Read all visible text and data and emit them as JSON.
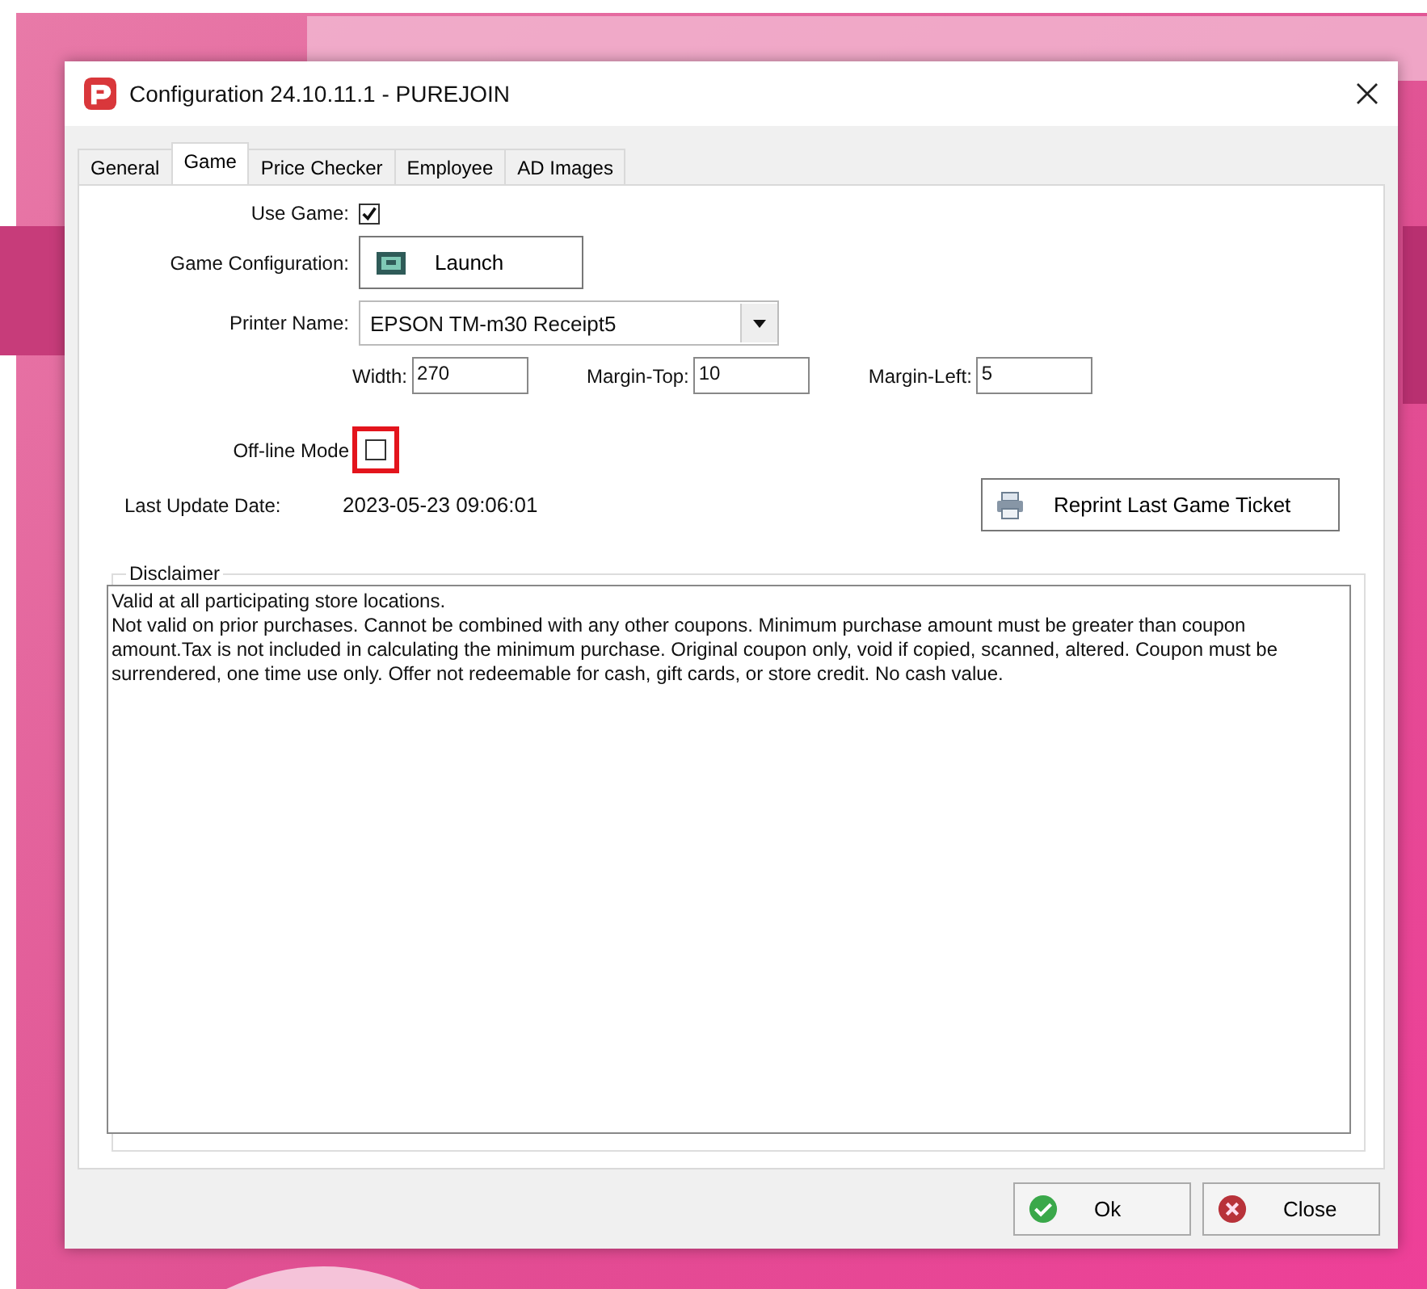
{
  "window": {
    "title": "Configuration 24.10.11.1  - PUREJOIN"
  },
  "tabs": [
    {
      "label": "General",
      "selected": false
    },
    {
      "label": "Game",
      "selected": true
    },
    {
      "label": "Price Checker",
      "selected": false
    },
    {
      "label": "Employee",
      "selected": false
    },
    {
      "label": "AD Images",
      "selected": false
    }
  ],
  "use_game": {
    "label": "Use Game:",
    "checked": true
  },
  "game_configuration": {
    "label": "Game Configuration:",
    "button": "Launch"
  },
  "printer_name": {
    "label": "Printer Name:",
    "value": "EPSON TM-m30 Receipt5"
  },
  "size_fields": [
    {
      "label": "Width:",
      "value": "270"
    },
    {
      "label": "Margin-Top:",
      "value": "10"
    },
    {
      "label": "Margin-Left:",
      "value": "5"
    }
  ],
  "offline_mode": {
    "label": "Off-line Mode",
    "checked": false,
    "highlighted": true
  },
  "last_update": {
    "label": "Last Update Date:",
    "value": "2023-05-23 09:06:01"
  },
  "reprint_button": "Reprint Last Game Ticket",
  "disclaimer": {
    "title": "Disclaimer",
    "text": "Valid at all participating store locations.\nNot valid on prior purchases. Cannot be combined with any other coupons. Minimum purchase amount must be greater than coupon amount.Tax is not included in calculating the minimum purchase. Original coupon only, void if copied, scanned, altered. Coupon must be surrendered, one time use only. Offer not redeemable for cash, gift cards, or store credit. No cash value."
  },
  "buttons": [
    {
      "kind": "ok",
      "label": "Ok"
    },
    {
      "kind": "close",
      "label": "Close"
    }
  ]
}
